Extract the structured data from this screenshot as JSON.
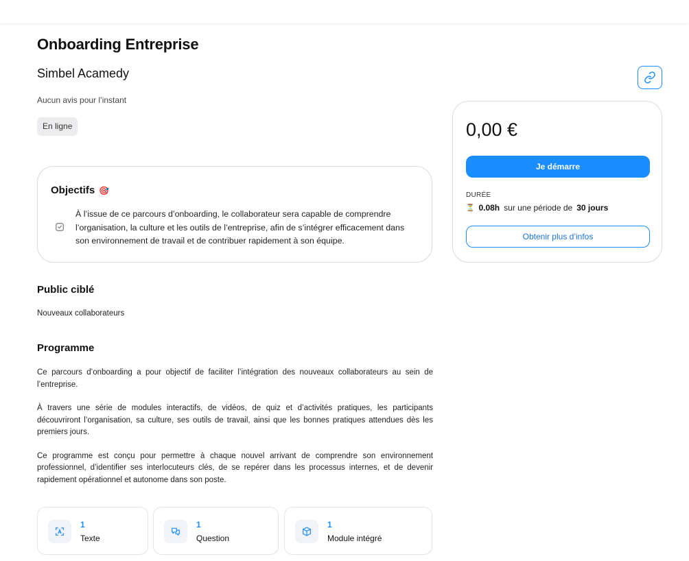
{
  "course": {
    "title": "Onboarding Entreprise",
    "provider": "Simbel Acamedy",
    "reviews": "Aucun avis pour l’instant",
    "mode": "En ligne"
  },
  "objectives": {
    "title": "Objectifs",
    "emoji": "🎯",
    "items": [
      "À l’issue de ce parcours d’onboarding, le collaborateur sera capable de comprendre l’organisation, la culture et les outils de l’entreprise, afin de s’intégrer efficacement dans son environnement de travail et de contribuer rapidement à son équipe."
    ]
  },
  "pricing": {
    "price": "0,00 €",
    "start_label": "Je démarre",
    "duration_label": "DURÉE",
    "hourglass": "⏳",
    "duration_value": "0.08h",
    "period_text": "sur une période de",
    "period_value": "30 jours",
    "info_label": "Obtenir plus d’infos"
  },
  "audience": {
    "title": "Public ciblé",
    "text": "Nouveaux collaborateurs"
  },
  "program": {
    "title": "Programme",
    "paragraphs": [
      "Ce parcours d’onboarding a pour objectif de faciliter l’intégration des nouveaux collaborateurs au sein de l’entreprise.",
      "À travers une série de modules interactifs, de vidéos, de quiz et d’activités pratiques, les participants découvriront l’organisation, sa culture, ses outils de travail, ainsi que les bonnes pratiques attendues dès les premiers jours.",
      "Ce programme est conçu pour permettre à chaque nouvel arrivant de comprendre son environnement professionnel, d’identifier ses interlocuteurs clés, de se repérer dans les processus internes, et de devenir rapidement opérationnel et autonome dans son poste."
    ]
  },
  "stats": [
    {
      "count": "1",
      "label": "Texte",
      "icon": "text-icon"
    },
    {
      "count": "1",
      "label": "Question",
      "icon": "question-icon"
    },
    {
      "count": "1",
      "label": "Module intégré",
      "icon": "module-icon"
    }
  ],
  "colors": {
    "accent": "#1a8dff",
    "card_border": "#d9d9de",
    "badge_bg": "#ececef"
  }
}
